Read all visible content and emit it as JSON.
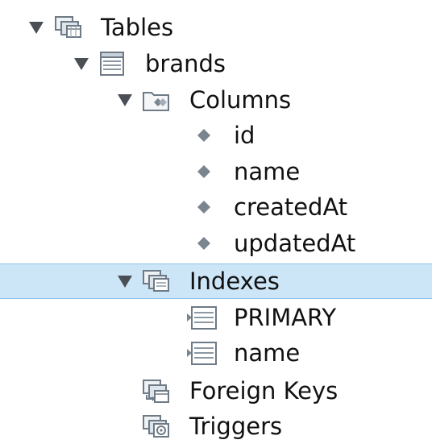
{
  "tree": {
    "tables_label": "Tables",
    "brands_label": "brands",
    "columns_label": "Columns",
    "column_items": [
      {
        "label": "id"
      },
      {
        "label": "name"
      },
      {
        "label": "createdAt"
      },
      {
        "label": "updatedAt"
      }
    ],
    "indexes_label": "Indexes",
    "index_items": [
      {
        "label": "PRIMARY"
      },
      {
        "label": "name"
      }
    ],
    "foreign_keys_label": "Foreign Keys",
    "triggers_label": "Triggers"
  },
  "colors": {
    "selection": "#cde6f7",
    "selection_border": "#8ec3e6",
    "arrow": "#4a4f55",
    "icon_stroke": "#6e7a86",
    "icon_fill": "#e9eef2",
    "column_diamond": "#7a858f"
  },
  "icons": {
    "tables": "tables-folder-icon",
    "brands": "table-grid-icon",
    "columns": "columns-folder-icon",
    "column": "column-diamond-icon",
    "indexes": "indexes-folder-icon",
    "index": "index-icon",
    "foreign_keys": "foreign-keys-icon",
    "triggers": "triggers-icon"
  }
}
